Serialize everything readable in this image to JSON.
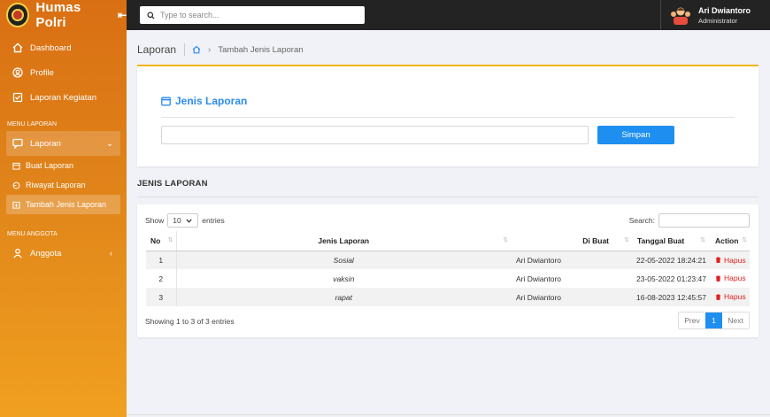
{
  "brand": {
    "title": "Humas Polri",
    "toggle": "⇤"
  },
  "sidebar": {
    "main_items": [
      {
        "label": "Dashboard",
        "icon": "home-icon"
      },
      {
        "label": "Profile",
        "icon": "user-circle-icon"
      },
      {
        "label": "Laporan Kegiatan",
        "icon": "checkbox-icon"
      }
    ],
    "section_laporan": "MENU LAPORAN",
    "laporan": {
      "label": "Laporan",
      "icon": "chat-icon",
      "chevron": "⌄"
    },
    "sub_items": [
      {
        "label": "Buat Laporan",
        "icon": "calendar-icon"
      },
      {
        "label": "Riwayat Laporan",
        "icon": "history-icon"
      },
      {
        "label": "Tambah Jenis Laporan",
        "icon": "calendar-plus-icon"
      }
    ],
    "section_anggota": "MENU ANGGOTA",
    "anggota": {
      "label": "Anggota",
      "icon": "person-icon",
      "chevron": "‹"
    }
  },
  "topbar": {
    "search_placeholder": "Type to search...",
    "user_name": "Ari Dwiantoro",
    "user_role": "Administrator"
  },
  "breadcrumb": {
    "title": "Laporan",
    "separator": "›",
    "current": "Tambah Jenis Laporan"
  },
  "form": {
    "heading": "Jenis Laporan",
    "input_value": "",
    "submit_label": "Simpan"
  },
  "section": {
    "title": "JENIS LAPORAN"
  },
  "table": {
    "show_label": "Show",
    "length_value": "10",
    "entries_label": "entries",
    "search_label": "Search:",
    "search_value": "",
    "columns": {
      "no": "No",
      "jenis": "Jenis Laporan",
      "buat": "Di Buat",
      "tanggal": "Tanggal Buat",
      "action": "Action"
    },
    "rows": [
      {
        "no": "1",
        "jenis": "Sosial",
        "buat": "Ari Dwiantoro",
        "tanggal": "22-05-2022 18:24:21",
        "action": "Hapus"
      },
      {
        "no": "2",
        "jenis": "vaksin",
        "buat": "Ari Dwiantoro",
        "tanggal": "23-05-2022 01:23:47",
        "action": "Hapus"
      },
      {
        "no": "3",
        "jenis": "rapat",
        "buat": "Ari Dwiantoro",
        "tanggal": "16-08-2023 12:45:57",
        "action": "Hapus"
      }
    ],
    "info": "Showing 1 to 3 of 3 entries",
    "pager": {
      "prev": "Prev",
      "current": "1",
      "next": "Next"
    }
  },
  "colors": {
    "accent": "#1e8ff0",
    "sidebar_top": "#d96f13",
    "sidebar_bottom": "#f0a020",
    "danger": "#e02020",
    "topbar": "#232323"
  }
}
